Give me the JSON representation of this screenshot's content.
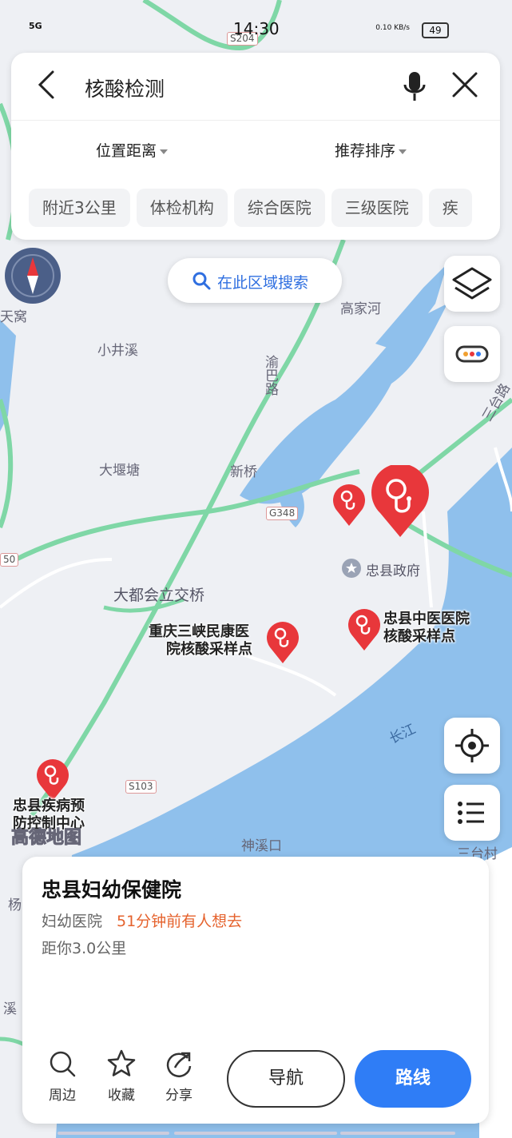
{
  "status": {
    "time": "14:30",
    "network": "5G",
    "speed": "0.10 KB/s",
    "battery": "49"
  },
  "search": {
    "query": "核酸检测",
    "sort_distance": "位置距离",
    "sort_recommend": "推荐排序",
    "chips": [
      "附近3公里",
      "体检机构",
      "综合医院",
      "三级医院",
      "疾"
    ]
  },
  "map": {
    "area_search": "在此区域搜索",
    "labels": [
      "高家河",
      "小井溪",
      "渝巴路",
      "大堰塘",
      "新桥",
      "大都会立交桥",
      "忠县政府",
      "长江",
      "神溪口",
      "三台村",
      "三台路",
      "天窝",
      "杨",
      "溪"
    ],
    "road_badges": [
      "S204",
      "G348",
      "S103",
      "50"
    ],
    "markers": [
      {
        "label1": "重庆三峡民康医",
        "label2": "院核酸采样点"
      },
      {
        "label1": "忠县中医医院",
        "label2": "核酸采样点"
      },
      {
        "label1": "忠县疾病预",
        "label2": "防控制中心"
      }
    ],
    "logo": "高德地图"
  },
  "poi": {
    "name": "忠县妇幼保健院",
    "category": "妇幼医院",
    "hot": "51分钟前有人想去",
    "distance": "距你3.0公里"
  },
  "actions": {
    "nearby": "周边",
    "favorite": "收藏",
    "share": "分享",
    "navigate": "导航",
    "route": "路线"
  },
  "colors": {
    "accent": "#2f7df6",
    "marker": "#e8373b",
    "water": "#8fc0ec",
    "road": "#7fd7a6"
  }
}
